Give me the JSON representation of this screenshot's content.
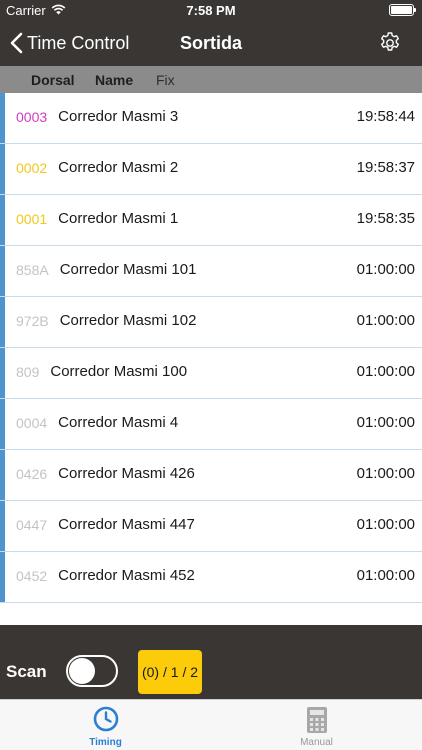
{
  "status_bar": {
    "carrier": "Carrier",
    "time": "7:58 PM",
    "battery_level": 1.0
  },
  "nav": {
    "back_label": "Time Control",
    "title": "Sortida",
    "settings_icon": "gear-icon"
  },
  "columns": {
    "dorsal": "Dorsal",
    "name": "Name",
    "fix": "Fix"
  },
  "rows": [
    {
      "dorsal": "0003",
      "dorsal_color": "#d23cc2",
      "name": "Corredor Masmi 3",
      "time": "19:58:44"
    },
    {
      "dorsal": "0002",
      "dorsal_color": "#f0c81e",
      "name": "Corredor Masmi 2",
      "time": "19:58:37"
    },
    {
      "dorsal": "0001",
      "dorsal_color": "#f0c81e",
      "name": "Corredor Masmi 1",
      "time": "19:58:35"
    },
    {
      "dorsal": "858A",
      "dorsal_color": "#c4c4c4",
      "name": "Corredor Masmi 101",
      "time": "01:00:00"
    },
    {
      "dorsal": "972B",
      "dorsal_color": "#c4c4c4",
      "name": "Corredor Masmi 102",
      "time": "01:00:00"
    },
    {
      "dorsal": "809",
      "dorsal_color": "#c4c4c4",
      "name": "Corredor Masmi 100",
      "time": "01:00:00"
    },
    {
      "dorsal": "0004",
      "dorsal_color": "#c4c4c4",
      "name": "Corredor Masmi 4",
      "time": "01:00:00"
    },
    {
      "dorsal": "0426",
      "dorsal_color": "#c4c4c4",
      "name": "Corredor Masmi 426",
      "time": "01:00:00"
    },
    {
      "dorsal": "0447",
      "dorsal_color": "#c4c4c4",
      "name": "Corredor Masmi 447",
      "time": "01:00:00"
    },
    {
      "dorsal": "0452",
      "dorsal_color": "#c4c4c4",
      "name": "Corredor Masmi 452",
      "time": "01:00:00"
    }
  ],
  "bottom": {
    "scan_label": "Scan",
    "scan_on": false,
    "counter": "(0) / 1 / 2"
  },
  "tabs": [
    {
      "label": "Timing",
      "icon": "clock-icon",
      "active": true
    },
    {
      "label": "Manual",
      "icon": "calculator-icon",
      "active": false
    }
  ],
  "colors": {
    "nav_bg": "#3a3633",
    "accent": "#2a7fd3",
    "row_bar": "#4f93cf",
    "counter_bg": "#fccc0a"
  }
}
